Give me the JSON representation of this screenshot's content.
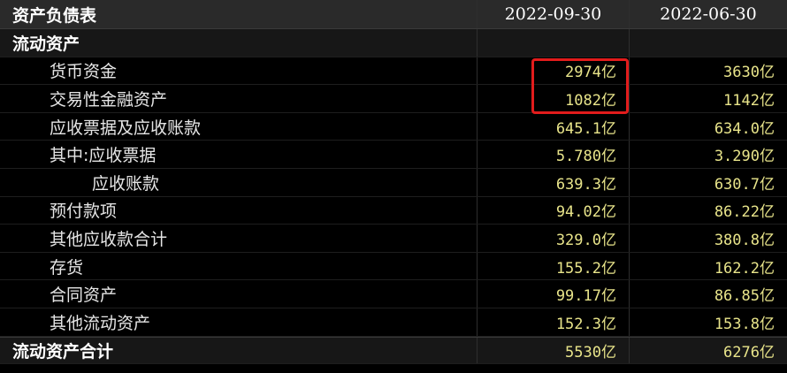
{
  "header": {
    "title": "资产负债表",
    "col1": "2022-09-30",
    "col2": "2022-06-30"
  },
  "section": {
    "label": "流动资产"
  },
  "rows": [
    {
      "label": "货币资金",
      "v1": "2974亿",
      "v2": "3630亿"
    },
    {
      "label": "交易性金融资产",
      "v1": "1082亿",
      "v2": "1142亿"
    },
    {
      "label": "应收票据及应收账款",
      "v1": "645.1亿",
      "v2": "634.0亿"
    },
    {
      "label": "其中:应收票据",
      "v1": "5.780亿",
      "v2": "3.290亿"
    },
    {
      "label": "应收账款",
      "v1": "639.3亿",
      "v2": "630.7亿"
    },
    {
      "label": "预付款项",
      "v1": "94.02亿",
      "v2": "86.22亿"
    },
    {
      "label": "其他应收款合计",
      "v1": "329.0亿",
      "v2": "380.8亿"
    },
    {
      "label": "存货",
      "v1": "155.2亿",
      "v2": "162.2亿"
    },
    {
      "label": "合同资产",
      "v1": "99.17亿",
      "v2": "86.85亿"
    },
    {
      "label": "其他流动资产",
      "v1": "152.3亿",
      "v2": "153.8亿"
    }
  ],
  "total": {
    "label": "流动资产合计",
    "v1": "5530亿",
    "v2": "6276亿"
  },
  "colors": {
    "background": "#000000",
    "value_text": "#e8e48a",
    "highlight_box": "#e21c1c"
  }
}
